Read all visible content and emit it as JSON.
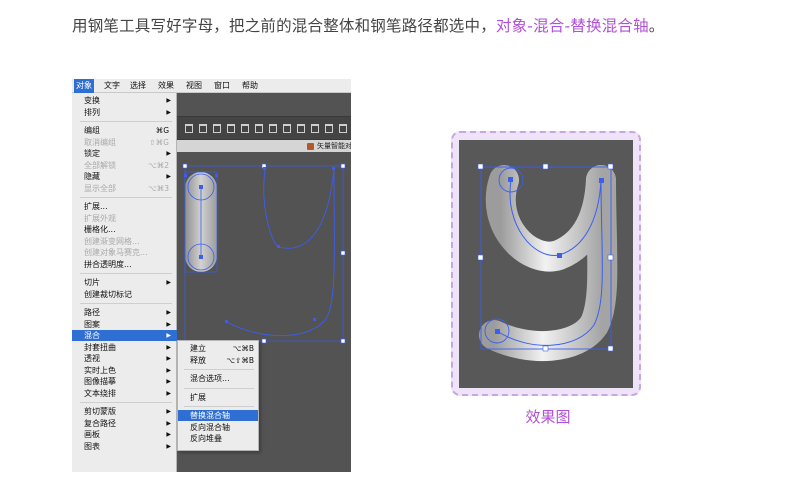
{
  "instruction": {
    "prefix": "用钢笔工具写好字母，把之前的混合整体和钢笔路径都选中，",
    "highlight": "对象-混合-替换混合轴",
    "suffix": "。"
  },
  "menubar": [
    "对象",
    "文字",
    "选择",
    "效果",
    "视图",
    "窗口",
    "帮助"
  ],
  "panel_label": "矢量智能对",
  "object_menu": [
    {
      "label": "变换",
      "arrow": "▶"
    },
    {
      "label": "排列",
      "arrow": "▶"
    },
    {
      "sep": true
    },
    {
      "label": "编组",
      "sc": "⌘G"
    },
    {
      "label": "取消编组",
      "sc": "⇧⌘G",
      "dis": true
    },
    {
      "label": "锁定",
      "arrow": "▶"
    },
    {
      "label": "全部解锁",
      "sc": "⌥⌘2",
      "dis": true
    },
    {
      "label": "隐藏",
      "arrow": "▶"
    },
    {
      "label": "显示全部",
      "sc": "⌥⌘3",
      "dis": true
    },
    {
      "sep": true
    },
    {
      "label": "扩展..."
    },
    {
      "label": "扩展外观",
      "dis": true
    },
    {
      "label": "栅格化..."
    },
    {
      "label": "创建渐变网格...",
      "dis": true
    },
    {
      "label": "创建对象马赛克...",
      "dis": true
    },
    {
      "label": "拼合透明度..."
    },
    {
      "sep": true
    },
    {
      "label": "切片",
      "arrow": "▶"
    },
    {
      "label": "创建裁切标记"
    },
    {
      "sep": true
    },
    {
      "label": "路径",
      "arrow": "▶"
    },
    {
      "label": "图案",
      "arrow": "▶"
    },
    {
      "label": "混合",
      "arrow": "▶",
      "hl": true
    },
    {
      "label": "封套扭曲",
      "arrow": "▶"
    },
    {
      "label": "透视",
      "arrow": "▶"
    },
    {
      "label": "实时上色",
      "arrow": "▶"
    },
    {
      "label": "图像描摹",
      "arrow": "▶"
    },
    {
      "label": "文本绕排",
      "arrow": "▶"
    },
    {
      "sep": true
    },
    {
      "label": "剪切蒙版",
      "arrow": "▶"
    },
    {
      "label": "复合路径",
      "arrow": "▶"
    },
    {
      "label": "画板",
      "arrow": "▶"
    },
    {
      "label": "图表",
      "arrow": "▶"
    }
  ],
  "blend_submenu": [
    {
      "label": "建立",
      "sc": "⌥⌘B"
    },
    {
      "label": "释放",
      "sc": "⌥⇧⌘B"
    },
    {
      "sep": true
    },
    {
      "label": "混合选项..."
    },
    {
      "sep": true
    },
    {
      "label": "扩展"
    },
    {
      "sep": true
    },
    {
      "label": "替换混合轴",
      "hl": true
    },
    {
      "label": "反向混合轴"
    },
    {
      "label": "反向堆叠"
    }
  ],
  "caption": "效果图",
  "colors": {
    "accent": "#b14fd6",
    "menu_highlight": "#2f6fd3",
    "selection": "#3a5ff0",
    "canvas": "#535353"
  }
}
